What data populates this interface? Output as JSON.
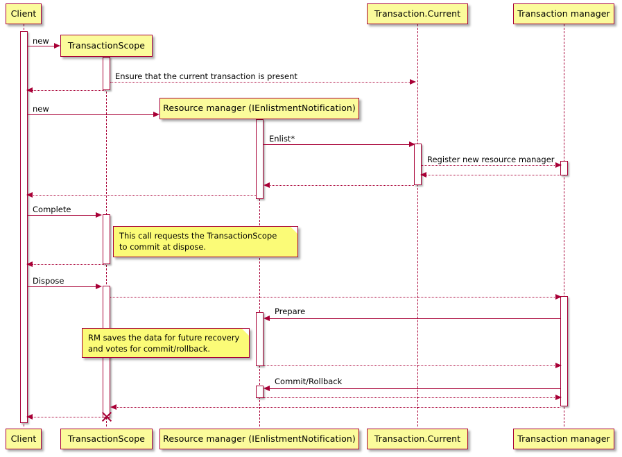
{
  "diagram": {
    "title": "TransactionScope sequence diagram",
    "type": "uml-sequence",
    "colors": {
      "participant_fill": "#FBFB9B",
      "note_fill": "#FBFB77",
      "line": "#A80036",
      "background": "#FFFFFF",
      "text": "#000000"
    }
  },
  "participants": [
    {
      "id": "client",
      "label": "Client"
    },
    {
      "id": "scope",
      "label": "TransactionScope"
    },
    {
      "id": "rm",
      "label": "Resource manager (IEnlistmentNotification)"
    },
    {
      "id": "current",
      "label": "Transaction.Current"
    },
    {
      "id": "tm",
      "label": "Transaction manager"
    }
  ],
  "messages": [
    {
      "index": 0,
      "label": "new",
      "from": "client",
      "to": "scope",
      "style": "solid",
      "direction": "right"
    },
    {
      "index": 1,
      "label": "Ensure that the current transaction is present",
      "from": "scope",
      "to": "current",
      "style": "dotted",
      "direction": "right"
    },
    {
      "index": 2,
      "label": "",
      "from": "scope",
      "to": "client",
      "style": "dotted",
      "direction": "left"
    },
    {
      "index": 3,
      "label": "new",
      "from": "client",
      "to": "rm",
      "style": "solid",
      "direction": "right"
    },
    {
      "index": 4,
      "label": "Enlist*",
      "from": "rm",
      "to": "current",
      "style": "solid",
      "direction": "right"
    },
    {
      "index": 5,
      "label": "Register new resource manager",
      "from": "current",
      "to": "tm",
      "style": "dotted",
      "direction": "right"
    },
    {
      "index": 6,
      "label": "",
      "from": "tm",
      "to": "current",
      "style": "dotted",
      "direction": "left"
    },
    {
      "index": 7,
      "label": "",
      "from": "current",
      "to": "rm",
      "style": "dotted",
      "direction": "left"
    },
    {
      "index": 8,
      "label": "",
      "from": "rm",
      "to": "client",
      "style": "dotted",
      "direction": "left"
    },
    {
      "index": 9,
      "label": "Complete",
      "from": "client",
      "to": "scope",
      "style": "solid",
      "direction": "right"
    },
    {
      "index": 10,
      "label": "",
      "from": "scope",
      "to": "client",
      "style": "dotted",
      "direction": "left"
    },
    {
      "index": 11,
      "label": "Dispose",
      "from": "client",
      "to": "scope",
      "style": "solid",
      "direction": "right"
    },
    {
      "index": 12,
      "label": "",
      "from": "scope",
      "to": "tm",
      "style": "dotted",
      "direction": "right"
    },
    {
      "index": 13,
      "label": "Prepare",
      "from": "tm",
      "to": "rm",
      "style": "solid",
      "direction": "left"
    },
    {
      "index": 14,
      "label": "",
      "from": "rm",
      "to": "tm",
      "style": "dotted",
      "direction": "right"
    },
    {
      "index": 15,
      "label": "Commit/Rollback",
      "from": "tm",
      "to": "rm",
      "style": "solid",
      "direction": "left"
    },
    {
      "index": 16,
      "label": "",
      "from": "rm",
      "to": "tm",
      "style": "dotted",
      "direction": "right"
    },
    {
      "index": 17,
      "label": "",
      "from": "tm",
      "to": "scope",
      "style": "dotted",
      "direction": "left"
    },
    {
      "index": 18,
      "label": "",
      "from": "scope",
      "to": "client",
      "style": "dotted",
      "direction": "left"
    }
  ],
  "notes": [
    {
      "index": 0,
      "text": "This call requests the TransactionScope\nto commit at dispose."
    },
    {
      "index": 1,
      "text": "RM saves the data for future recovery\nand votes for commit/rollback."
    }
  ]
}
